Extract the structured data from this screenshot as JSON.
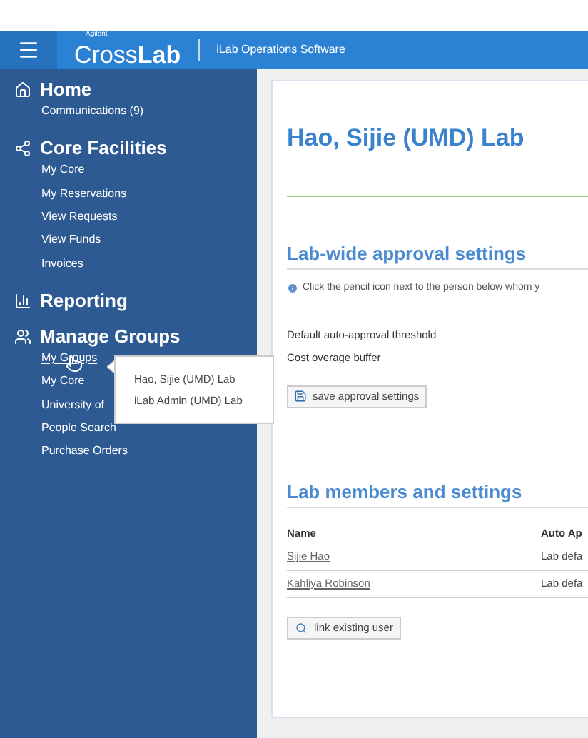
{
  "header": {
    "logo_small": "Agilent",
    "logo_light": "Cross",
    "logo_bold": "Lab",
    "product": "iLab Operations Software"
  },
  "sidebar": {
    "sections": [
      {
        "kind": "home",
        "title": "Home",
        "items": [
          {
            "label": "Communications (9)",
            "hovered": false
          }
        ]
      },
      {
        "kind": "share",
        "title": "Core Facilities",
        "items": [
          {
            "label": "My Core",
            "hovered": false
          },
          {
            "label": "My Reservations",
            "hovered": false
          },
          {
            "label": "View Requests",
            "hovered": false
          },
          {
            "label": "View Funds",
            "hovered": false
          },
          {
            "label": "Invoices",
            "hovered": false
          }
        ]
      },
      {
        "kind": "chart",
        "title": "Reporting"
      },
      {
        "kind": "groups",
        "title": "Manage Groups",
        "items": [
          {
            "label": "My Groups",
            "hovered": true
          },
          {
            "label": "My Core",
            "hovered": false
          },
          {
            "label": "University of",
            "hovered": false
          },
          {
            "label": "People Search",
            "hovered": false
          },
          {
            "label": "Purchase Orders",
            "hovered": false
          }
        ]
      }
    ]
  },
  "popup": {
    "items": [
      "Hao, Sijie (UMD) Lab",
      "iLab Admin (UMD) Lab"
    ]
  },
  "main": {
    "title": "Hao, Sijie (UMD) Lab",
    "approval": {
      "heading": "Lab-wide approval settings",
      "info": "Click the pencil icon next to the person below whom y",
      "fields": [
        "Default auto-approval threshold",
        "Cost overage buffer"
      ],
      "button": "save approval settings"
    },
    "members": {
      "heading": "Lab members and settings",
      "columns": [
        "Name",
        "Auto Ap"
      ],
      "rows": [
        {
          "name": "Sijie Hao",
          "setting": "Lab defa"
        },
        {
          "name": "Kahliya Robinson",
          "setting": "Lab defa"
        }
      ],
      "button": "link existing user"
    }
  }
}
